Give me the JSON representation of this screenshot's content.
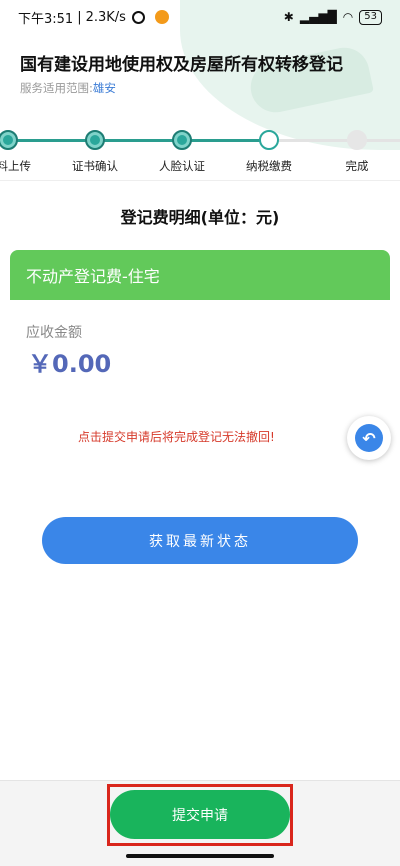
{
  "status_bar": {
    "time": "下午3:51",
    "speed": "2.3K/s",
    "separator": "|",
    "battery": "53",
    "bluetooth_icon": "bluetooth-icon",
    "signal_icon": "signal-icon",
    "wifi_icon": "wifi-icon"
  },
  "header": {
    "title": "国有建设用地使用权及房屋所有权转移登记",
    "scope_label": "服务适用范围:",
    "scope_value": "雄安"
  },
  "steps": [
    {
      "label": "资料上传",
      "state": "done"
    },
    {
      "label": "证书确认",
      "state": "done"
    },
    {
      "label": "人脸认证",
      "state": "done"
    },
    {
      "label": "纳税缴费",
      "state": "current"
    },
    {
      "label": "完成",
      "state": "todo"
    }
  ],
  "main": {
    "section_title": "登记费明细(单位：元)",
    "fee_item": "不动产登记费-住宅",
    "amount_label": "应收金额",
    "amount_value": "￥0.00",
    "warning": "点击提交申请后将完成登记无法撤回!",
    "refresh_button": "获取最新状态"
  },
  "footer": {
    "submit_button": "提交申请"
  },
  "colors": {
    "accent_green": "#62c95a",
    "primary_blue": "#3a86e8",
    "submit_green": "#19b45c",
    "warning_red": "#d63a2b",
    "step_teal": "#2aa79b"
  }
}
